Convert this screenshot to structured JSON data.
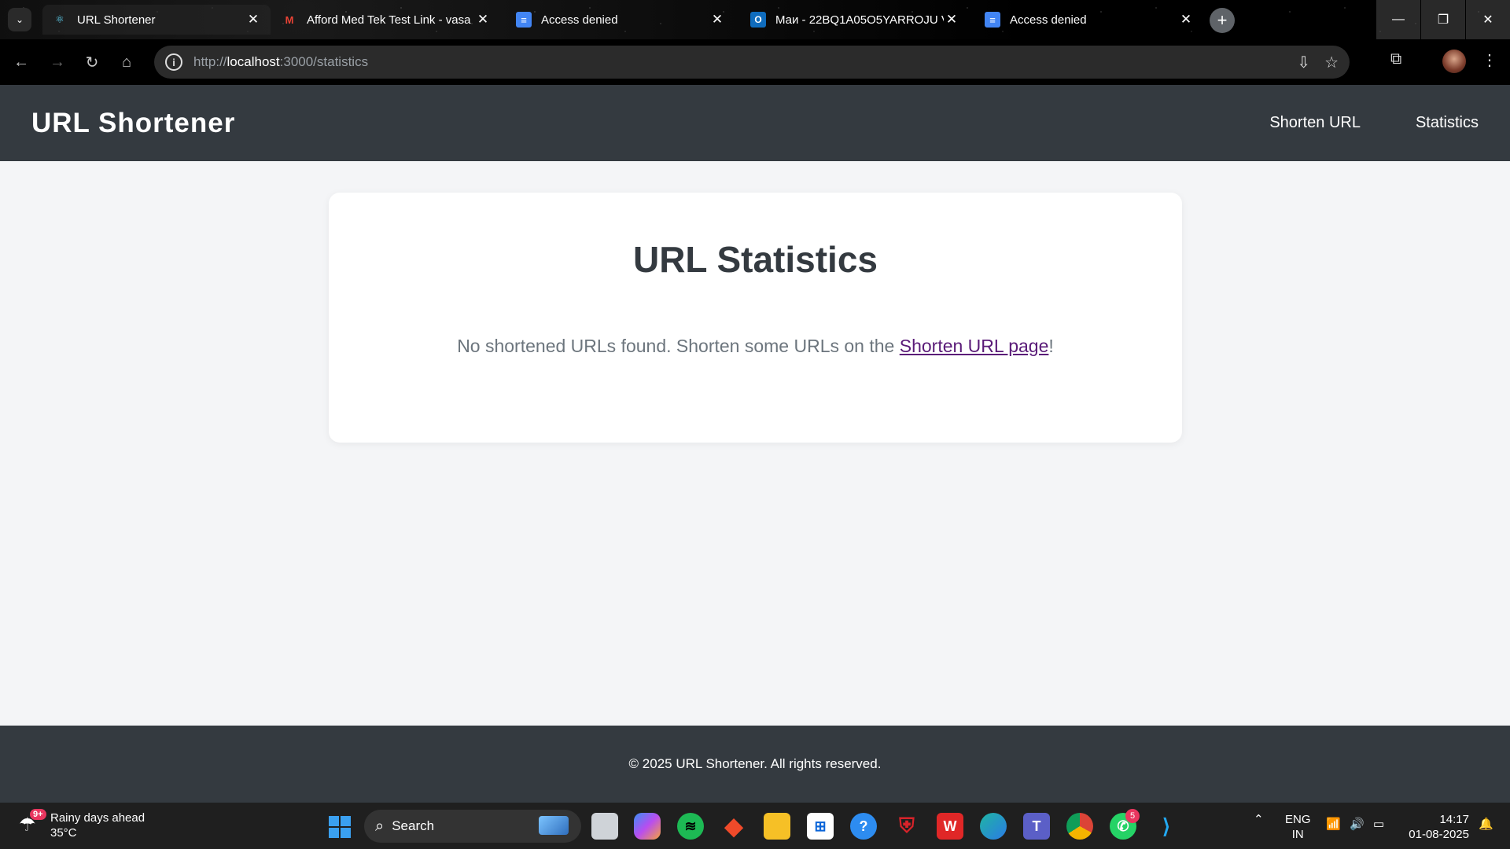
{
  "browser": {
    "tabs": [
      {
        "label": "URL Shortener",
        "icon": "react-icon",
        "active": true
      },
      {
        "label": "Afford Med Tek Test Link - vasa",
        "icon": "gmail-icon",
        "active": false
      },
      {
        "label": "Access denied",
        "icon": "docs-icon",
        "active": false
      },
      {
        "label": "Маи - 22BQ1A05O5YARROJU V",
        "icon": "outlook-icon",
        "active": false
      },
      {
        "label": "Access denied",
        "icon": "docs-icon",
        "active": false
      }
    ],
    "url_scheme": "http://",
    "url_host": "localhost",
    "url_path": ":3000/statistics"
  },
  "header": {
    "brand": "URL Shortener",
    "nav": [
      {
        "label": "Shorten URL"
      },
      {
        "label": "Statistics"
      }
    ]
  },
  "main": {
    "title": "URL Statistics",
    "message_prefix": "No shortened URLs found. Shorten some URLs on the ",
    "message_link": "Shorten URL page",
    "message_suffix": "!"
  },
  "footer": {
    "text": "© 2025 URL Shortener. All rights reserved."
  },
  "taskbar": {
    "weather_title": "Rainy days ahead",
    "weather_temp": "35°C",
    "weather_badge": "9+",
    "search_label": "Search",
    "whatsapp_badge": "5",
    "lang_line1": "ENG",
    "lang_line2": "IN",
    "time": "14:17",
    "date": "01-08-2025"
  },
  "colors": {
    "header_bg": "#343a40",
    "page_bg": "#f4f5f7",
    "link": "#5a1b78"
  }
}
